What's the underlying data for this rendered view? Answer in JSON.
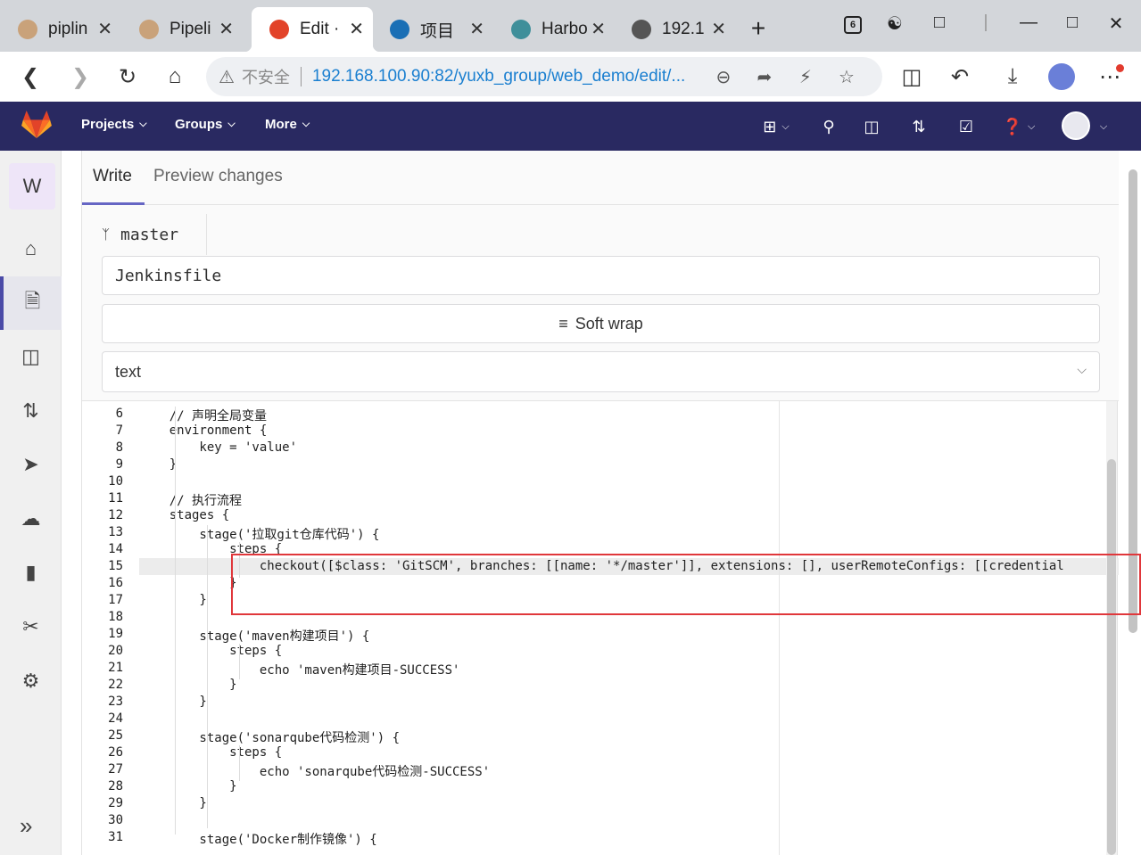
{
  "browser": {
    "tabs": [
      {
        "title": "piplin",
        "favicon": "jenkins-icon",
        "color": "#c9a27a"
      },
      {
        "title": "Pipeli",
        "favicon": "jenkins-icon",
        "color": "#c9a27a"
      },
      {
        "title": "Edit ·",
        "favicon": "gitlab-icon",
        "color": "#e24329"
      },
      {
        "title": "项目",
        "favicon": "harbor-wave-icon",
        "color": "#1a6fb5"
      },
      {
        "title": "Harbo",
        "favicon": "harbor-icon",
        "color": "#3f8f9a"
      },
      {
        "title": "192.1",
        "favicon": "network-icon",
        "color": "#555555"
      }
    ],
    "tab_count_badge": "6",
    "address": {
      "security_label": "不安全",
      "url": "192.168.100.90:82/yuxb_group/web_demo/edit/..."
    }
  },
  "gitlab": {
    "nav": {
      "projects": "Projects",
      "groups": "Groups",
      "more": "More"
    },
    "brand_color": "#292961",
    "sidebar": {
      "project_initial": "W",
      "items": [
        "home-icon",
        "repository-icon",
        "issues-icon",
        "merge-requests-icon",
        "ci-cd-icon",
        "deployments-icon",
        "wiki-icon",
        "snippets-icon",
        "settings-icon"
      ],
      "active_index": 1
    },
    "editor": {
      "tab_write": "Write",
      "tab_preview": "Preview changes",
      "branch": "master",
      "filename": "Jenkinsfile",
      "soft_wrap": "Soft wrap",
      "file_type": "text",
      "cursor_line": 15
    },
    "code_lines": [
      {
        "n": "6",
        "t": "    // 声明全局变量"
      },
      {
        "n": "7",
        "t": "    environment {"
      },
      {
        "n": "8",
        "t": "        key = 'value'"
      },
      {
        "n": "9",
        "t": "    }"
      },
      {
        "n": "10",
        "t": ""
      },
      {
        "n": "11",
        "t": "    // 执行流程"
      },
      {
        "n": "12",
        "t": "    stages {"
      },
      {
        "n": "13",
        "t": "        stage('拉取git仓库代码') {"
      },
      {
        "n": "14",
        "t": "            steps {"
      },
      {
        "n": "15",
        "t": "                checkout([$class: 'GitSCM', branches: [[name: '*/master']], extensions: [], userRemoteConfigs: [[credential"
      },
      {
        "n": "16",
        "t": "            }"
      },
      {
        "n": "17",
        "t": "        }"
      },
      {
        "n": "18",
        "t": ""
      },
      {
        "n": "19",
        "t": "        stage('maven构建项目') {"
      },
      {
        "n": "20",
        "t": "            steps {"
      },
      {
        "n": "21",
        "t": "                echo 'maven构建项目-SUCCESS'"
      },
      {
        "n": "22",
        "t": "            }"
      },
      {
        "n": "23",
        "t": "        }"
      },
      {
        "n": "24",
        "t": ""
      },
      {
        "n": "25",
        "t": "        stage('sonarqube代码检测') {"
      },
      {
        "n": "26",
        "t": "            steps {"
      },
      {
        "n": "27",
        "t": "                echo 'sonarqube代码检测-SUCCESS'"
      },
      {
        "n": "28",
        "t": "            }"
      },
      {
        "n": "29",
        "t": "        }"
      },
      {
        "n": "30",
        "t": ""
      },
      {
        "n": "31",
        "t": "        stage('Docker制作镜像') {"
      }
    ],
    "highlight_color": "#e0373b"
  }
}
